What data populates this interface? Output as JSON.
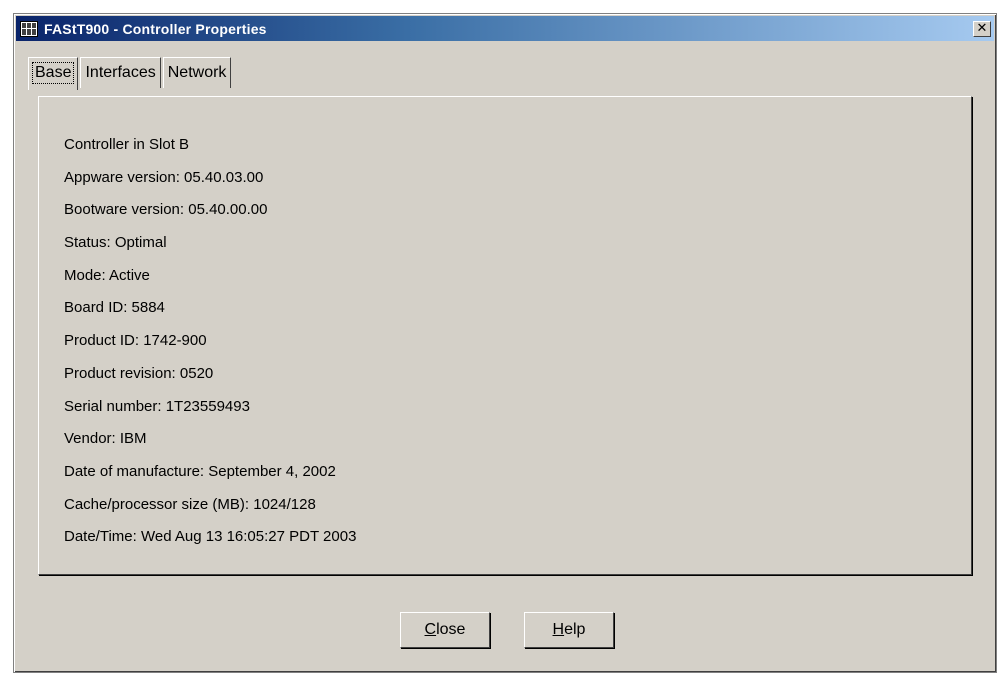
{
  "window": {
    "title": "FAStT900 - Controller Properties",
    "close_glyph": "✕",
    "icon": "grid-app-icon"
  },
  "tabs": [
    {
      "label": "Base",
      "active": true
    },
    {
      "label": "Interfaces",
      "active": false
    },
    {
      "label": "Network",
      "active": false
    }
  ],
  "base": {
    "lines": [
      "Controller in Slot B",
      "Appware version: 05.40.03.00",
      "Bootware version: 05.40.00.00",
      "Status: Optimal",
      "Mode: Active",
      "Board ID: 5884",
      "Product ID: 1742-900",
      "Product revision: 0520",
      "Serial number: 1T23559493",
      "Vendor: IBM",
      "Date of manufacture: September 4, 2002",
      "Cache/processor size (MB): 1024/128",
      "Date/Time: Wed Aug 13 16:05:27 PDT 2003"
    ]
  },
  "buttons": {
    "close": {
      "mnemonic": "C",
      "rest": "lose"
    },
    "help": {
      "mnemonic": "H",
      "rest": "elp"
    }
  },
  "colors": {
    "face": "#d4d0c8",
    "title_start": "#0a246a",
    "title_end": "#a6caf0"
  }
}
